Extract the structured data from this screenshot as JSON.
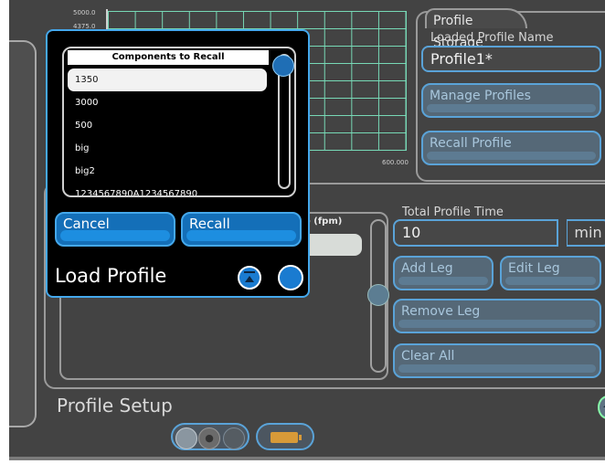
{
  "chart": {
    "y_top_label": "5000.0",
    "y_second_label": "4375.0",
    "x_right_label": "600.000"
  },
  "storage": {
    "tab_title": "Profile Storage",
    "loaded_label": "Loaded Profile Name",
    "loaded_value": "Profile1*",
    "manage_label": "Manage Profiles",
    "recall_label": "Recall Profile"
  },
  "setup": {
    "rate_header": "e (fpm)",
    "total_time_label": "Total Profile Time",
    "total_time_value": "10",
    "total_time_unit": "min",
    "add_leg": "Add Leg",
    "edit_leg": "Edit Leg",
    "remove_leg": "Remove Leg",
    "clear_all": "Clear All",
    "title": "Profile Setup"
  },
  "dialog": {
    "list_header": "Components to Recall",
    "items": [
      "1350",
      "3000",
      "500",
      "big",
      "big2",
      "1234567890A1234567890"
    ],
    "selected_index": 0,
    "cancel_label": "Cancel",
    "recall_label": "Recall",
    "title": "Load Profile"
  },
  "colors": {
    "background": "#434343",
    "accent": "#44a8ec",
    "button_fill": "#146fb8",
    "grid": "#77d9b6"
  }
}
